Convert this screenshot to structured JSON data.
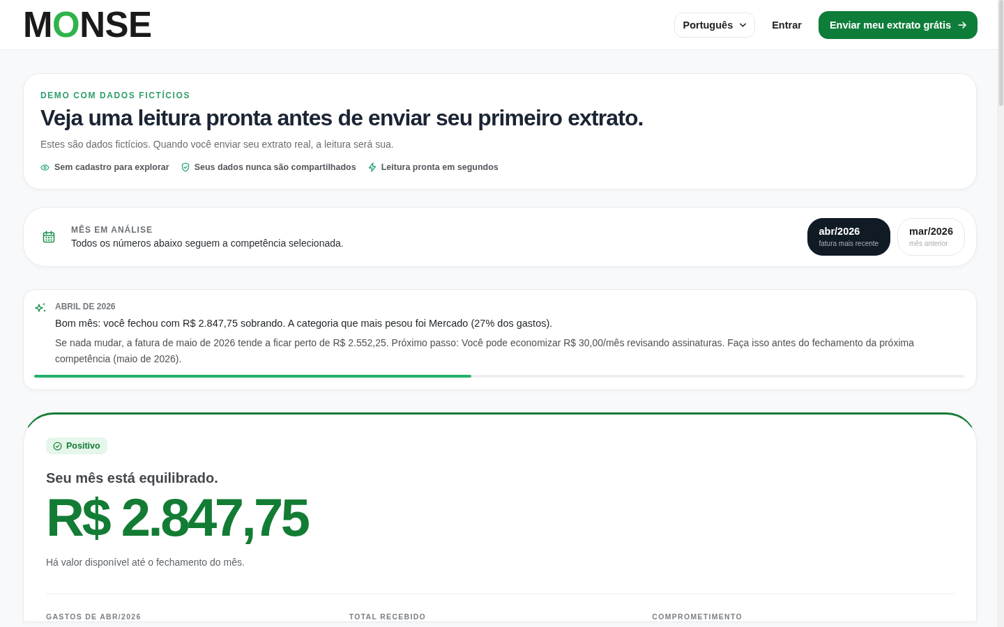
{
  "header": {
    "logo": {
      "before": "M",
      "accent": "O",
      "after": "NSE"
    },
    "language": "Português",
    "login": "Entrar",
    "cta": "Enviar meu extrato grátis"
  },
  "hero": {
    "eyebrow": "DEMO COM DADOS FICTÍCIOS",
    "title": "Veja uma leitura pronta antes de enviar seu primeiro extrato.",
    "subtitle": "Estes são dados fictícios. Quando você enviar seu extrato real, a leitura será sua.",
    "features": [
      {
        "kind": "eye",
        "text": "Sem cadastro para explorar"
      },
      {
        "kind": "shield",
        "text": "Seus dados nunca são compartilhados"
      },
      {
        "kind": "bolt",
        "text": "Leitura pronta em segundos"
      }
    ]
  },
  "month_picker": {
    "label": "MÊS EM ANÁLISE",
    "description": "Todos os números abaixo seguem a competência selecionada.",
    "months": [
      {
        "label": "abr/2026",
        "note": "fatura mais recente",
        "selected": true
      },
      {
        "label": "mar/2026",
        "note": "mês anterior",
        "selected": false
      }
    ]
  },
  "insight": {
    "heading": "ABRIL DE 2026",
    "summary": "Bom mês: você fechou com R$ 2.847,75 sobrando. A categoria que mais pesou foi Mercado (27% dos gastos).",
    "detail": "Se nada mudar, a fatura de maio de 2026 tende a ficar perto de R$ 2.552,25. Próximo passo: Você pode economizar R$ 30,00/mês revisando assinaturas. Faça isso antes do fechamento da próxima competência (maio de 2026).",
    "progress": {
      "level": 0.47
    }
  },
  "summary": {
    "badge": {
      "kind": "positive",
      "label": "Positivo"
    },
    "headline": "Seu mês está equilibrado.",
    "amount": "R$ 2.847,75",
    "note": "Há valor disponível até o fechamento do mês.",
    "metrics": [
      "GASTOS DE ABR/2026",
      "TOTAL RECEBIDO",
      "COMPROMETIMENTO"
    ]
  }
}
